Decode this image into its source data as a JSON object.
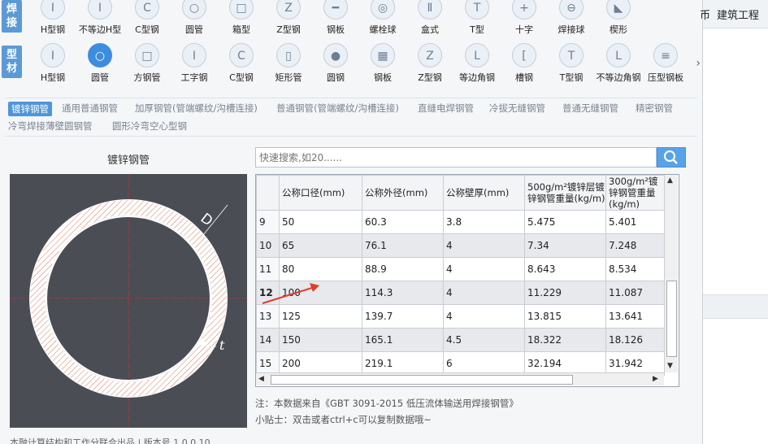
{
  "weld_tag": "焊接",
  "profile_tag": "型材",
  "row1": [
    "H型钢",
    "不等边H型",
    "C型钢",
    "圆管",
    "箱型",
    "Z型钢",
    "钢板",
    "螺栓球",
    "盒式",
    "T型",
    "十字",
    "焊接球",
    "楔形"
  ],
  "row2": [
    "H型钢",
    "圆管",
    "方钢管",
    "工字钢",
    "C型钢",
    "矩形管",
    "圆钢",
    "钢板",
    "Z型钢",
    "等边角钢",
    "槽钢",
    "T型钢",
    "不等边角钢",
    "压型钢板"
  ],
  "row1_icons": [
    "I",
    "I",
    "C",
    "○",
    "□",
    "Z",
    "━",
    "◎",
    "Ⅱ",
    "T",
    "+",
    "⊖",
    "◣"
  ],
  "row2_icons": [
    "I",
    "○",
    "□",
    "I",
    "C",
    "▯",
    "●",
    "▦",
    "Z",
    "L",
    "[",
    "T",
    "L",
    "≡"
  ],
  "more_icon": "›",
  "subtabs": [
    "镀锌钢管",
    "通用普通钢管",
    "加厚钢管(管端螺纹/沟槽连接)",
    "普通钢管(管端螺纹/沟槽连接)",
    "直缝电焊钢管",
    "冷拔无缝钢管",
    "普通无缝钢管",
    "精密钢管",
    "冷弯焊接薄壁圆钢管",
    "圆形冷弯空心型钢"
  ],
  "diagram_title": "镀锌钢管",
  "dim_D": "D",
  "dim_t": "t",
  "search_placeholder": "快速搜索,如20......",
  "columns": [
    "",
    "公称口径(mm)",
    "公称外径(mm)",
    "公称壁厚(mm)",
    "500g/m²镀锌层镀锌钢管重量(kg/m)",
    "300g/m²镀锌钢管重量(kg/m)"
  ],
  "rows": [
    [
      "9",
      "50",
      "60.3",
      "3.8",
      "5.475",
      "5.401"
    ],
    [
      "10",
      "65",
      "76.1",
      "4",
      "7.34",
      "7.248"
    ],
    [
      "11",
      "80",
      "88.9",
      "4",
      "8.643",
      "8.534"
    ],
    [
      "12",
      "100",
      "114.3",
      "4",
      "11.229",
      "11.087"
    ],
    [
      "13",
      "125",
      "139.7",
      "4",
      "13.815",
      "13.641"
    ],
    [
      "14",
      "150",
      "165.1",
      "4.5",
      "18.322",
      "18.126"
    ],
    [
      "15",
      "200",
      "219.1",
      "6",
      "32.194",
      "31.942"
    ]
  ],
  "note1": "注：本数据来自《GBT 3091-2015 低压流体输送用焊接钢管》",
  "note2": "小贴士：双击或者ctrl+c可以复制数据哦~",
  "footer": "本融计算结构和工作分联合出品  |  版本号 1.0.0.10",
  "right_pane": {
    "t1": "币",
    "t2": "建筑工程"
  },
  "colors": {
    "accent": "#3c8dde",
    "ring": "#ffffff",
    "diagram_bg": "#4a4d54",
    "arrow": "#e23b2e"
  }
}
